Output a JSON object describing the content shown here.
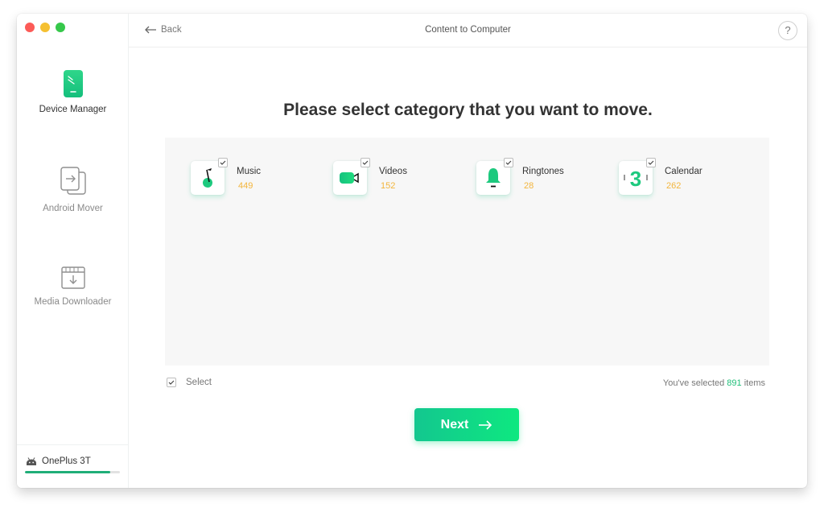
{
  "window": {
    "title": "Content to Computer",
    "traffic_lights": [
      "close",
      "minimize",
      "maximize"
    ]
  },
  "sidebar": {
    "items": [
      {
        "label": "Device Manager",
        "icon": "phone-icon",
        "active": true
      },
      {
        "label": "Android Mover",
        "icon": "transfer-icon",
        "active": false
      },
      {
        "label": "Media Downloader",
        "icon": "download-icon",
        "active": false
      }
    ],
    "device": {
      "name": "OnePlus 3T",
      "icon": "android-icon",
      "storage_used_fraction": 0.9
    }
  },
  "header": {
    "back_label": "Back",
    "title": "Content to Computer",
    "help_label": "?"
  },
  "main": {
    "prompt": "Please select category that you want to move.",
    "categories": [
      {
        "name": "Music",
        "count": "449",
        "icon": "music-note-icon",
        "checked": true
      },
      {
        "name": "Videos",
        "count": "152",
        "icon": "video-camera-icon",
        "checked": true
      },
      {
        "name": "Ringtones",
        "count": "28",
        "icon": "bell-icon",
        "checked": true
      },
      {
        "name": "Calendar",
        "count": "262",
        "icon": "calendar-icon",
        "calendar_day": "3",
        "checked": true
      }
    ],
    "select_all": {
      "label": "Select",
      "checked": true
    },
    "summary": {
      "prefix": "You've selected ",
      "count": "891",
      "suffix": " items"
    },
    "next_label": "Next"
  },
  "colors": {
    "accent": "#1fbf79",
    "count": "#f3b53c",
    "button_gradient_start": "#13c78f",
    "button_gradient_end": "#0ee880"
  }
}
